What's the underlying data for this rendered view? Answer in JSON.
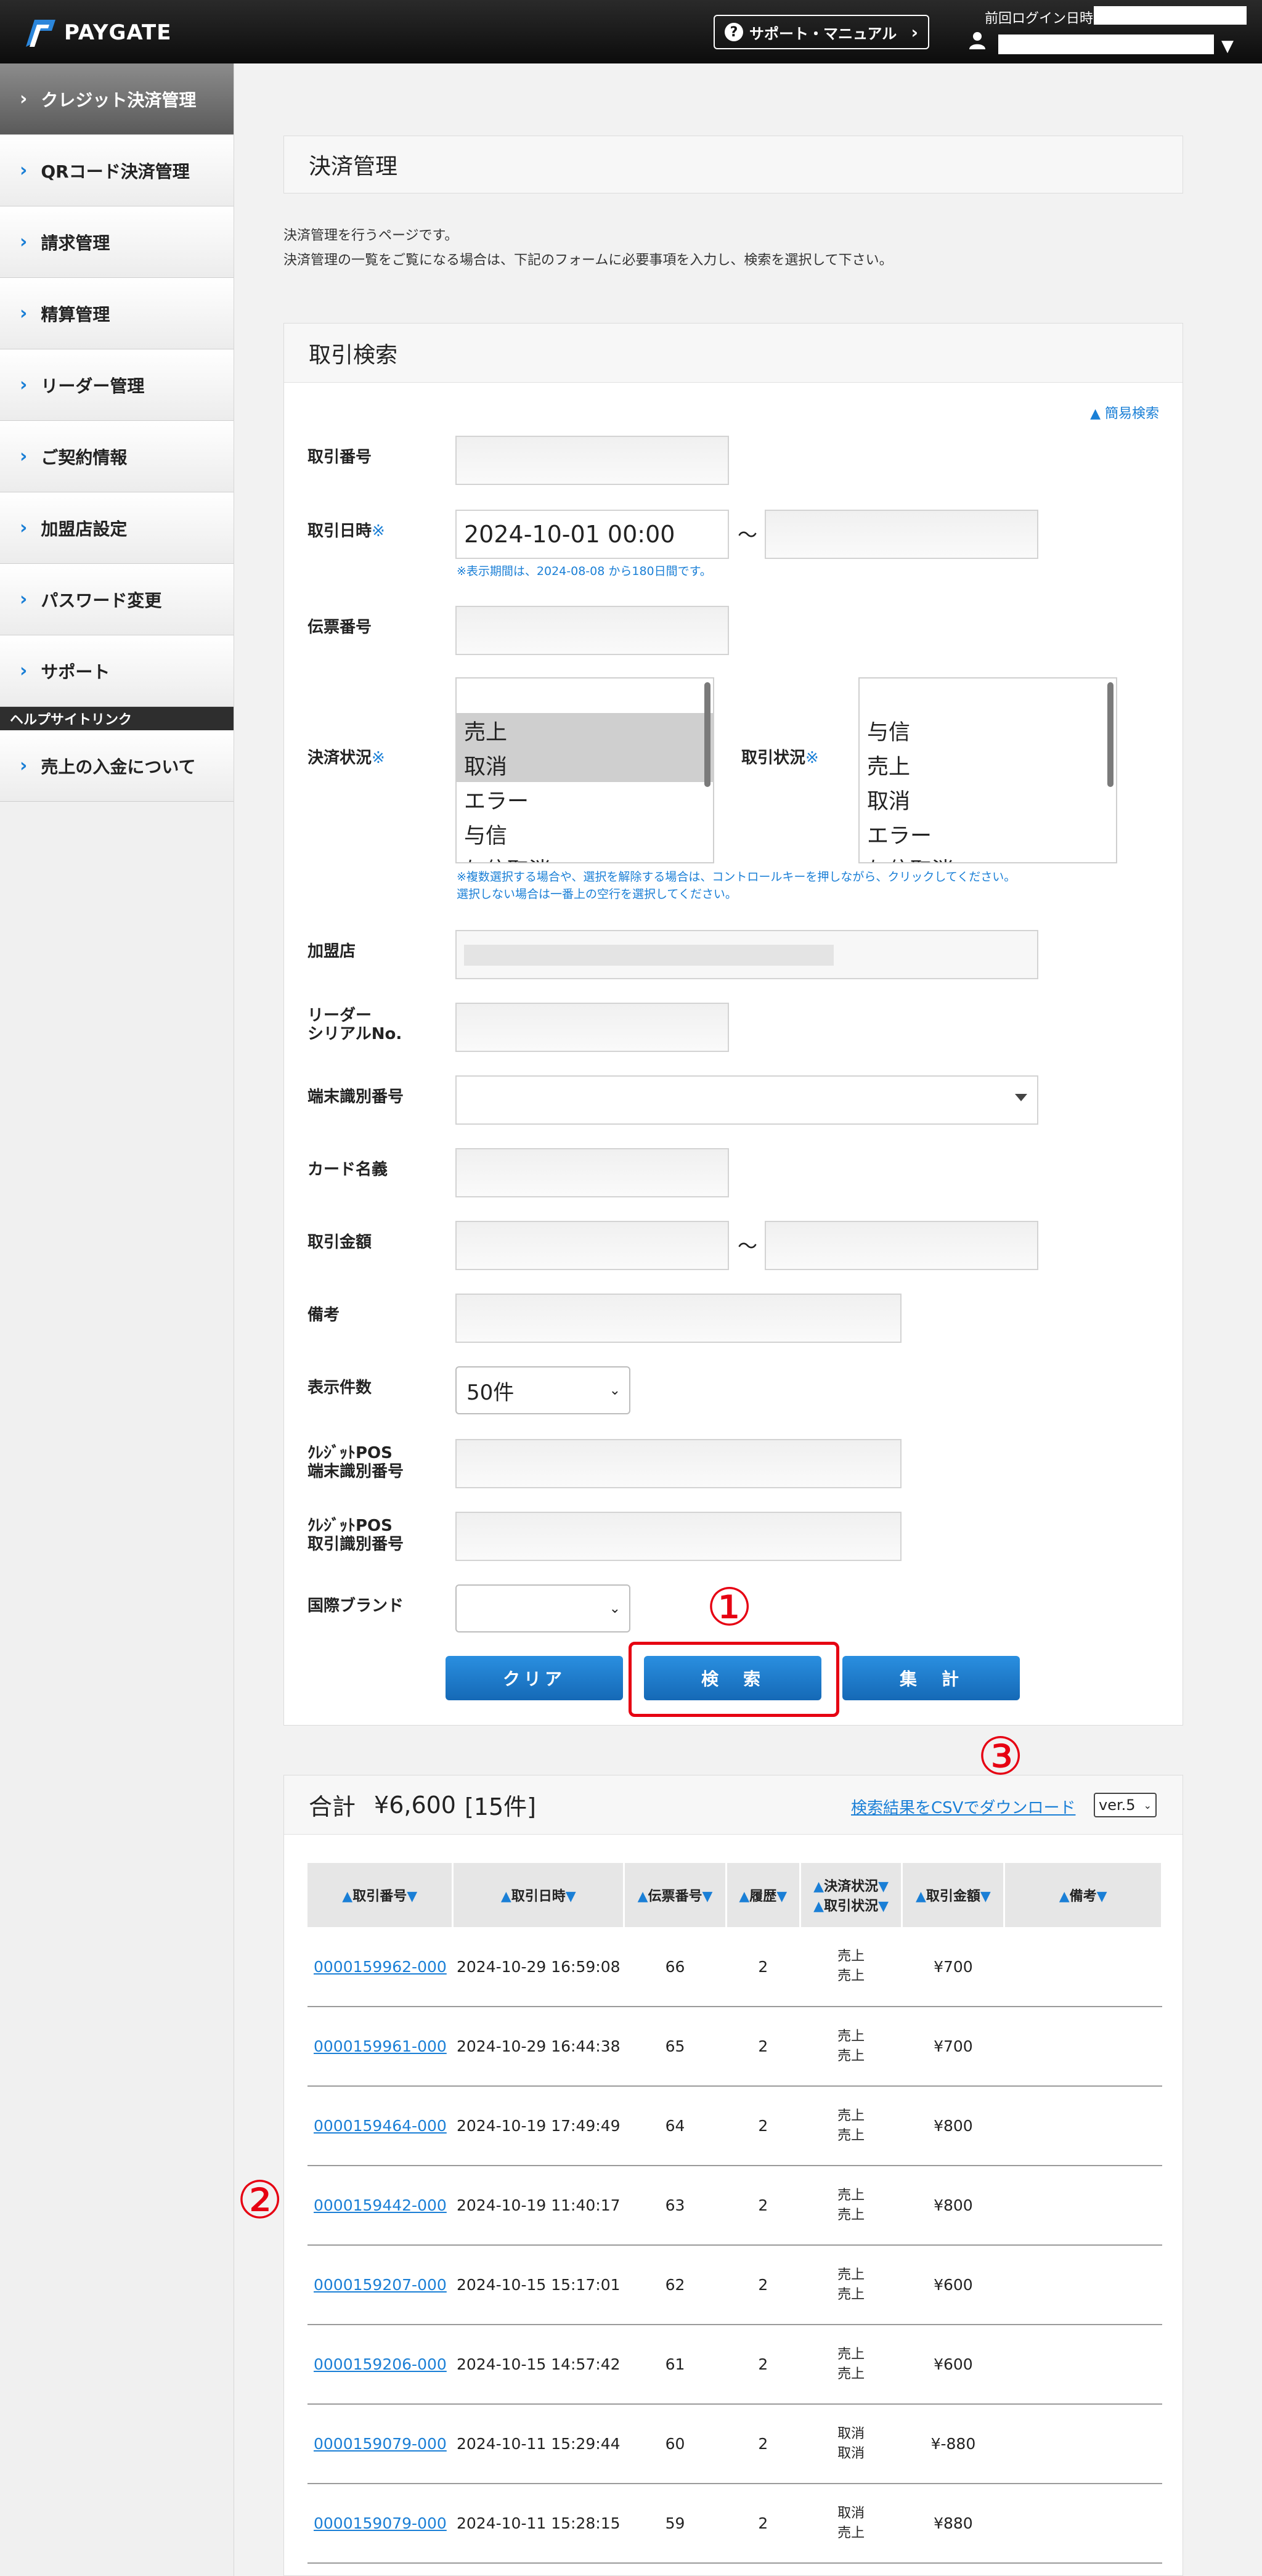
{
  "header": {
    "brand": "PAYGATE",
    "support_label": "サポート・マニュアル",
    "last_login_label": "前回ログイン日時"
  },
  "sidebar": {
    "items": [
      {
        "label": "クレジット決済管理"
      },
      {
        "label": "QRコード決済管理"
      },
      {
        "label": "請求管理"
      },
      {
        "label": "精算管理"
      },
      {
        "label": "リーダー管理"
      },
      {
        "label": "ご契約情報"
      },
      {
        "label": "加盟店設定"
      },
      {
        "label": "パスワード変更"
      },
      {
        "label": "サポート"
      }
    ],
    "help_header": "ヘルプサイトリンク",
    "help_items": [
      {
        "label": "売上の入金について"
      }
    ]
  },
  "main": {
    "title": "決済管理",
    "desc1": "決済管理を行うページです。",
    "desc2": "決済管理の一覧をご覧になる場合は、下記のフォームに必要事項を入力し、検索を選択して下さい。"
  },
  "search": {
    "title": "取引検索",
    "simple_search": "▲ 簡易検索",
    "labels": {
      "txn_no": "取引番号",
      "txn_date": "取引日時",
      "slip_no": "伝票番号",
      "pay_status": "決済状況",
      "txn_status": "取引状況",
      "merchant": "加盟店",
      "reader_1": "リーダー",
      "reader_2": "シリアルNo.",
      "terminal_id": "端末識別番号",
      "card_name": "カード名義",
      "amount": "取引金額",
      "memo": "備考",
      "display_count": "表示件数",
      "pos_term_1": "ｸﾚｼﾞｯﾄPOS",
      "pos_term_2": "端末識別番号",
      "pos_txn_1": "ｸﾚｼﾞｯﾄPOS",
      "pos_txn_2": "取引識別番号",
      "brand": "国際ブランド"
    },
    "required_mark": "※",
    "date_from": "2024-10-01 00:00",
    "tilde": "～",
    "date_note": "※表示期間は、2024-08-08 から180日間です。",
    "pay_status_options": [
      "",
      "売上",
      "取消",
      "エラー",
      "与信",
      "与信取消"
    ],
    "txn_status_options": [
      "",
      "与信",
      "売上",
      "取消",
      "エラー",
      "与信取消"
    ],
    "multi_note_1": "※複数選択する場合や、選択を解除する場合は、コントロールキーを押しながら、クリックしてください。",
    "multi_note_2": "選択しない場合は一番上の空行を選択してください。",
    "display_count_value": "50件",
    "btn_clear": "クリア",
    "btn_search": "検　索",
    "btn_total": "集　計"
  },
  "annotations": {
    "n1": "①",
    "n2": "②",
    "n3": "③"
  },
  "results": {
    "total_label": "合計",
    "total_amount": "¥6,600",
    "total_count": "[15件]",
    "csv_link": "検索結果をCSVでダウンロード",
    "csv_version": "ver.5",
    "columns": {
      "txn_no": "取引番号",
      "txn_date": "取引日時",
      "slip_no": "伝票番号",
      "history": "履歴",
      "pay_status": "決済状況",
      "txn_status": "取引状況",
      "amount": "取引金額",
      "memo": "備考"
    },
    "rows": [
      {
        "id": "0000159962-000",
        "date": "2024-10-29 16:59:08",
        "slip": "66",
        "hist": "2",
        "pay": "売上",
        "txn": "売上",
        "amount": "¥700",
        "memo": ""
      },
      {
        "id": "0000159961-000",
        "date": "2024-10-29 16:44:38",
        "slip": "65",
        "hist": "2",
        "pay": "売上",
        "txn": "売上",
        "amount": "¥700",
        "memo": ""
      },
      {
        "id": "0000159464-000",
        "date": "2024-10-19 17:49:49",
        "slip": "64",
        "hist": "2",
        "pay": "売上",
        "txn": "売上",
        "amount": "¥800",
        "memo": ""
      },
      {
        "id": "0000159442-000",
        "date": "2024-10-19 11:40:17",
        "slip": "63",
        "hist": "2",
        "pay": "売上",
        "txn": "売上",
        "amount": "¥800",
        "memo": ""
      },
      {
        "id": "0000159207-000",
        "date": "2024-10-15 15:17:01",
        "slip": "62",
        "hist": "2",
        "pay": "売上",
        "txn": "売上",
        "amount": "¥600",
        "memo": ""
      },
      {
        "id": "0000159206-000",
        "date": "2024-10-15 14:57:42",
        "slip": "61",
        "hist": "2",
        "pay": "売上",
        "txn": "売上",
        "amount": "¥600",
        "memo": ""
      },
      {
        "id": "0000159079-000",
        "date": "2024-10-11 15:29:44",
        "slip": "60",
        "hist": "2",
        "pay": "取消",
        "txn": "取消",
        "amount": "¥-880",
        "memo": ""
      },
      {
        "id": "0000159079-000",
        "date": "2024-10-11 15:28:15",
        "slip": "59",
        "hist": "2",
        "pay": "取消",
        "txn": "売上",
        "amount": "¥880",
        "memo": ""
      }
    ]
  },
  "colors": {
    "accent": "#1a7fd6",
    "annotation": "#e60012",
    "header_bg": "#111111"
  }
}
